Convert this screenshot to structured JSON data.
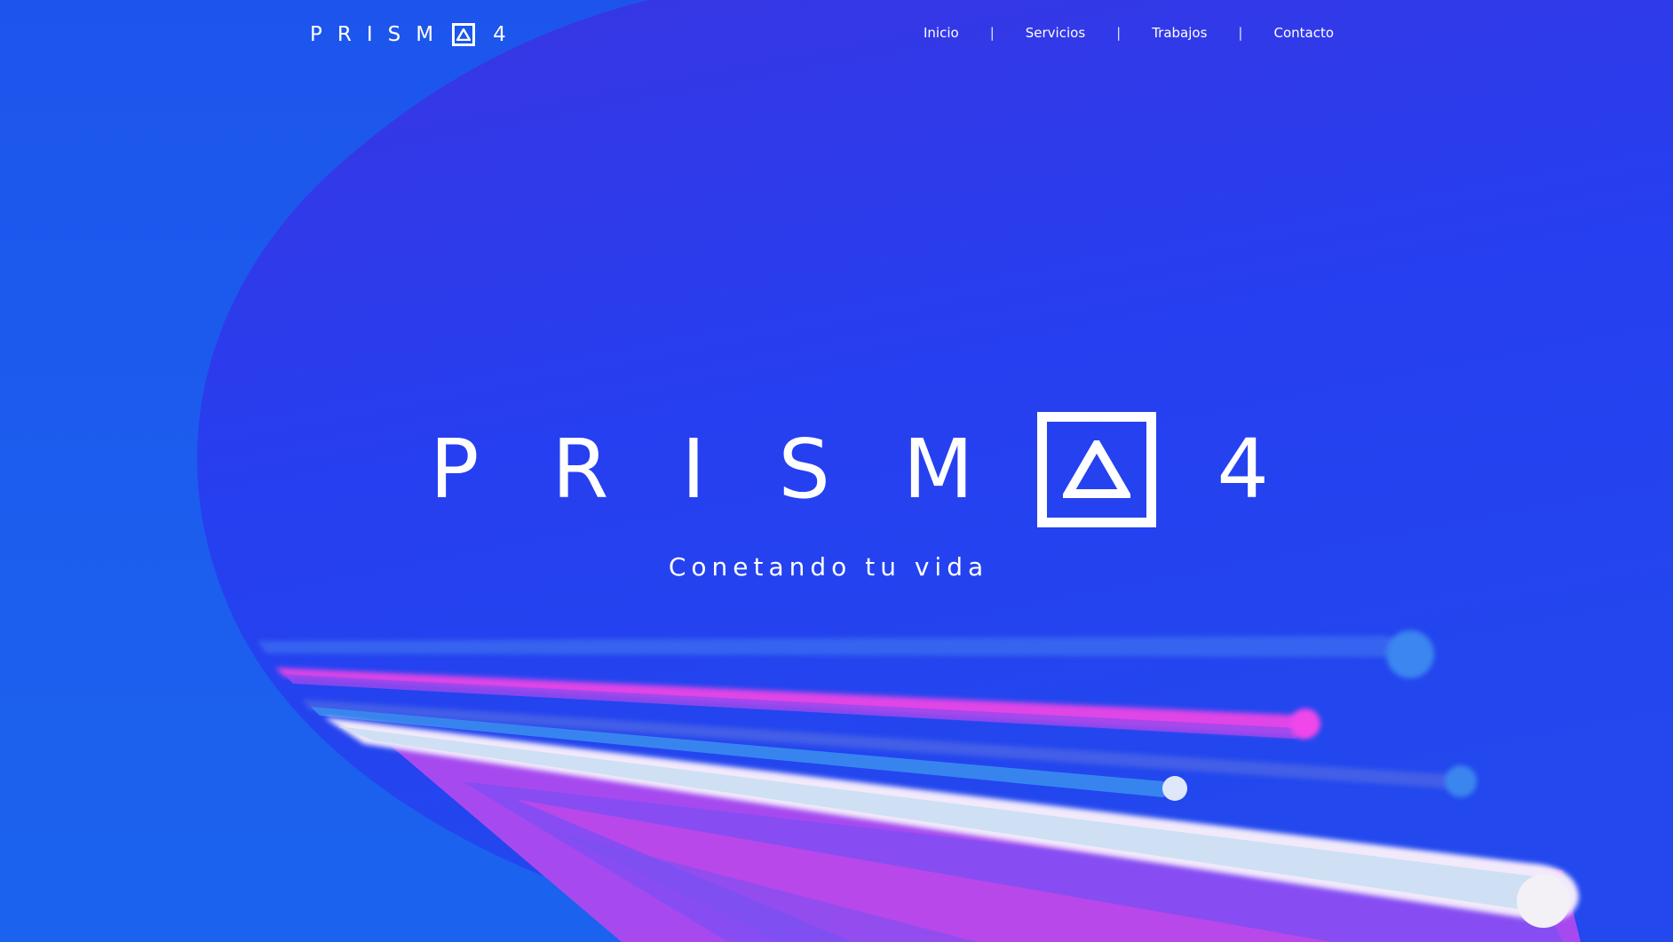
{
  "header": {
    "logo": {
      "letters": "PRISM",
      "number": "4",
      "icon": "triangle-in-square-icon"
    },
    "nav": {
      "items": [
        {
          "label": "Inicio"
        },
        {
          "label": "Servicios"
        },
        {
          "label": "Trabajos"
        },
        {
          "label": "Contacto"
        }
      ],
      "separator": "|"
    }
  },
  "hero": {
    "letters": "PRISM",
    "number": "4",
    "icon": "triangle-in-square-icon",
    "tagline": "Conetando tu vida"
  },
  "colors": {
    "background_blue": "#1b5cee",
    "blob_indigo": "#2f3ae6",
    "streak_pink": "#e443e8",
    "streak_purple": "#b04bf0",
    "streak_white": "#e8eefc",
    "text": "#ffffff"
  }
}
